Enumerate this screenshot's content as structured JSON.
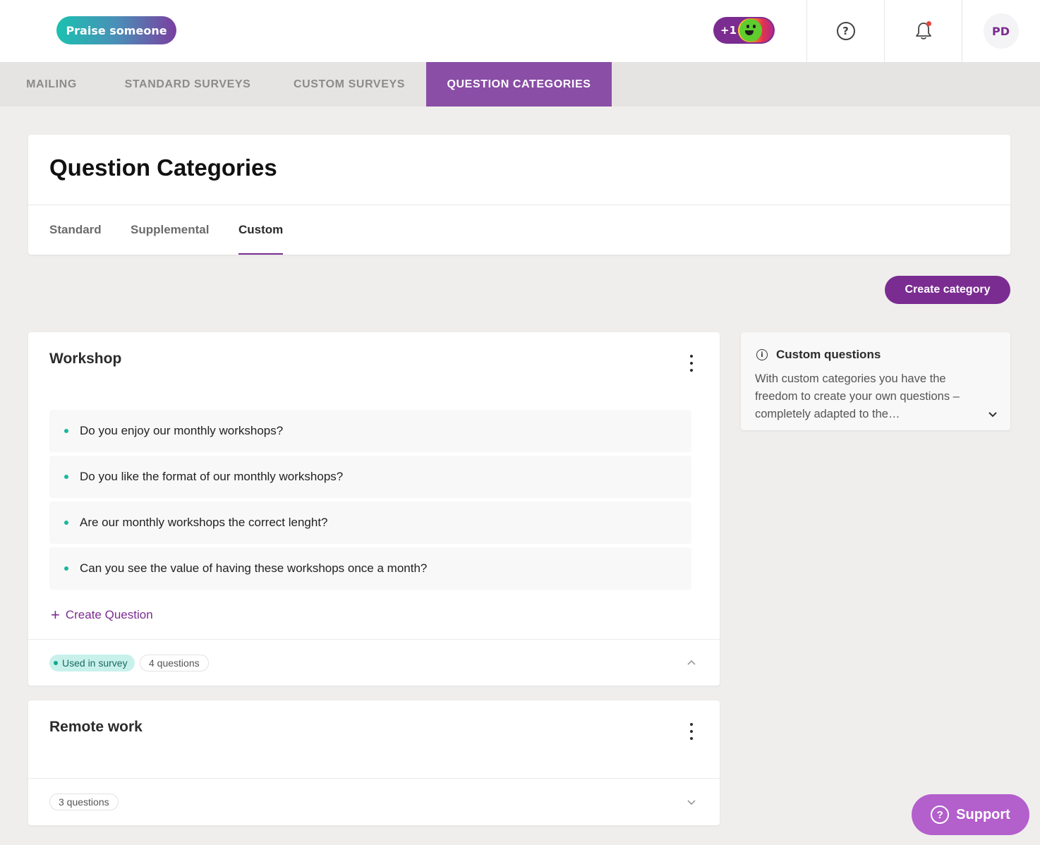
{
  "header": {
    "praise_label": "Praise someone",
    "plus_one_label": "+1",
    "avatar_initials": "PD",
    "help_glyph": "?"
  },
  "nav": {
    "tabs": [
      {
        "label": "MAILING"
      },
      {
        "label": "STANDARD SURVEYS"
      },
      {
        "label": "CUSTOM SURVEYS"
      },
      {
        "label": "QUESTION CATEGORIES"
      }
    ],
    "active_index": 3
  },
  "page": {
    "title": "Question Categories",
    "sub_tabs": [
      {
        "label": "Standard"
      },
      {
        "label": "Supplemental"
      },
      {
        "label": "Custom"
      }
    ],
    "active_sub_tab": 2,
    "create_category_label": "Create category"
  },
  "categories": [
    {
      "title": "Workshop",
      "questions": [
        "Do you enjoy our monthly workshops?",
        "Do you like the format of our monthly workshops?",
        "Are our monthly workshops the correct lenght?",
        "Can you see the value of having these workshops once a month?"
      ],
      "create_question_label": "Create Question",
      "used_badge": "Used in survey",
      "count_badge": "4 questions",
      "expanded": true
    },
    {
      "title": "Remote work",
      "count_badge": "3 questions",
      "expanded": false
    }
  ],
  "info": {
    "title": "Custom questions",
    "text": "With custom categories you have the freedom to create your own questions – completely adapted to the…",
    "icon_glyph": "i"
  },
  "support": {
    "label": "Support",
    "icon_glyph": "?"
  },
  "colors": {
    "brand_purple": "#7b2c91",
    "active_tab": "#8a4ea6",
    "teal": "#1bb79c",
    "support": "#b35fcc"
  }
}
